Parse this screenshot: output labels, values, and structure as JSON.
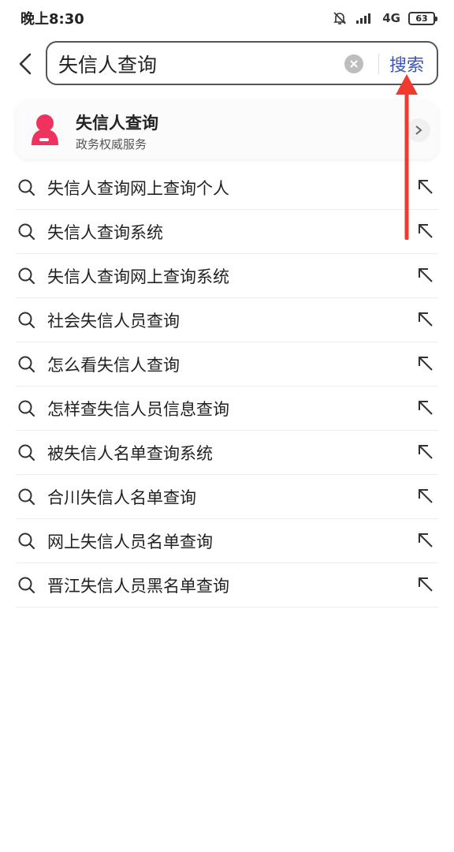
{
  "status_bar": {
    "time": "晚上8:30",
    "network": "4G",
    "battery": "63"
  },
  "search": {
    "query": "失信人查询",
    "button_label": "搜索"
  },
  "service_card": {
    "title": "失信人查询",
    "subtitle": "政务权威服务"
  },
  "suggestions": [
    "失信人查询网上查询个人",
    "失信人查询系统",
    "失信人查询网上查询系统",
    "社会失信人员查询",
    "怎么看失信人查询",
    "怎样查失信人员信息查询",
    "被失信人名单查询系统",
    "合川失信人名单查询",
    "网上失信人员名单查询",
    "晋江失信人员黑名单查询"
  ],
  "colors": {
    "accent": "#3a56b6",
    "logo": "#f0325f",
    "annotation_arrow": "#ef3b2d"
  },
  "icons": [
    "back-icon",
    "clear-icon",
    "search-icon",
    "fill-query-icon",
    "chevron-right-icon",
    "mute-bell-icon",
    "signal-icon",
    "battery-icon"
  ]
}
